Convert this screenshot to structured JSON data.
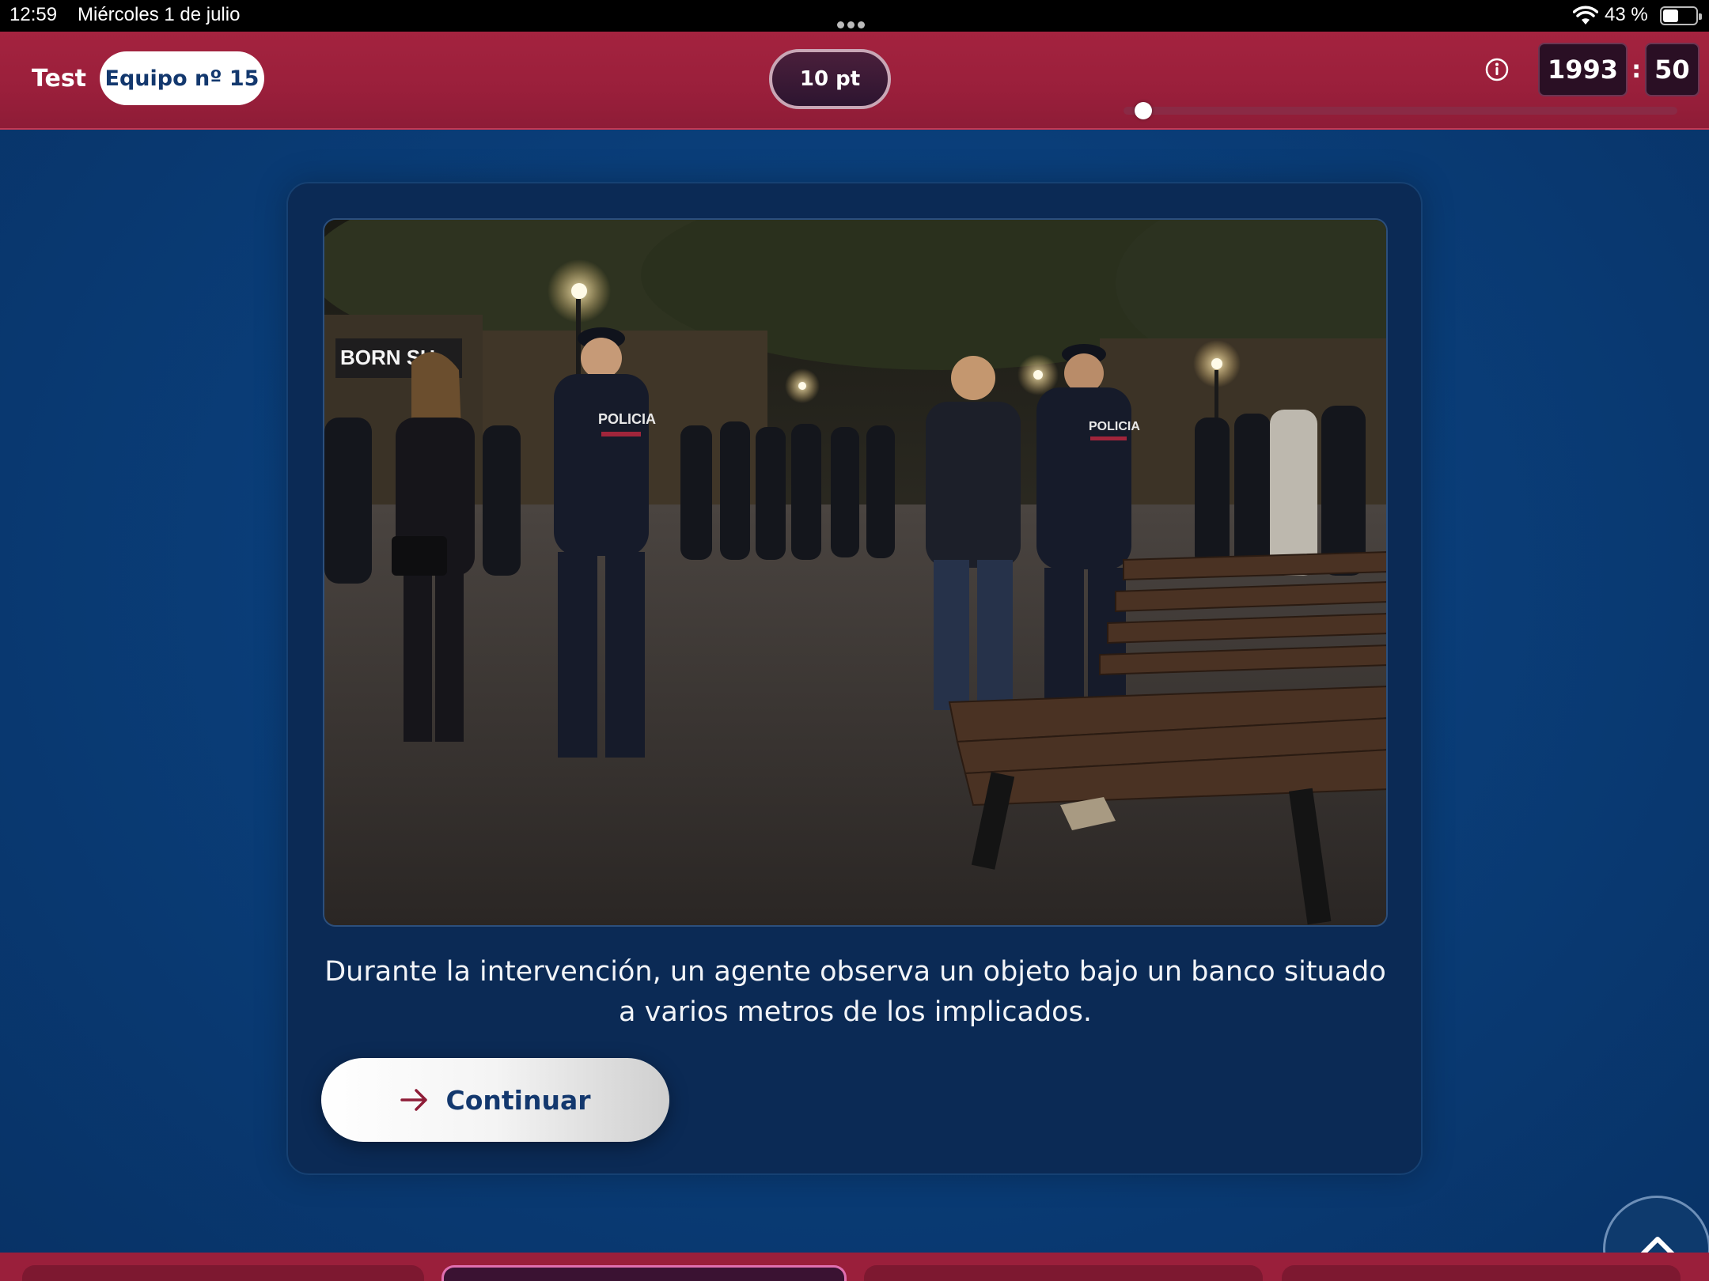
{
  "status_bar": {
    "time": "12:59",
    "date": "Miércoles 1 de julio",
    "battery": "43 %"
  },
  "header": {
    "title": "Test",
    "team": "Equipo nº 15",
    "points": "10 pt",
    "timer_minutes": "1993",
    "timer_separator": ":",
    "timer_seconds": "50",
    "progress_fraction": 0.02
  },
  "card": {
    "scene_sign": "BORN SU",
    "police_label_left": "POLICIA",
    "police_label_right": "POLICIA",
    "caption": "Durante la intervención, un agente observa un objeto bajo un banco situado a varios metros de los implicados.",
    "continue_label": "Continuar"
  },
  "colors": {
    "header": "#9a1f3b",
    "background": "#0a3f7b",
    "card": "#0b2a55",
    "accent_text": "#13386e"
  },
  "icons": {
    "info": "info-icon",
    "continue": "arrow-right-icon",
    "scroll_top": "chevron-up-icon"
  }
}
